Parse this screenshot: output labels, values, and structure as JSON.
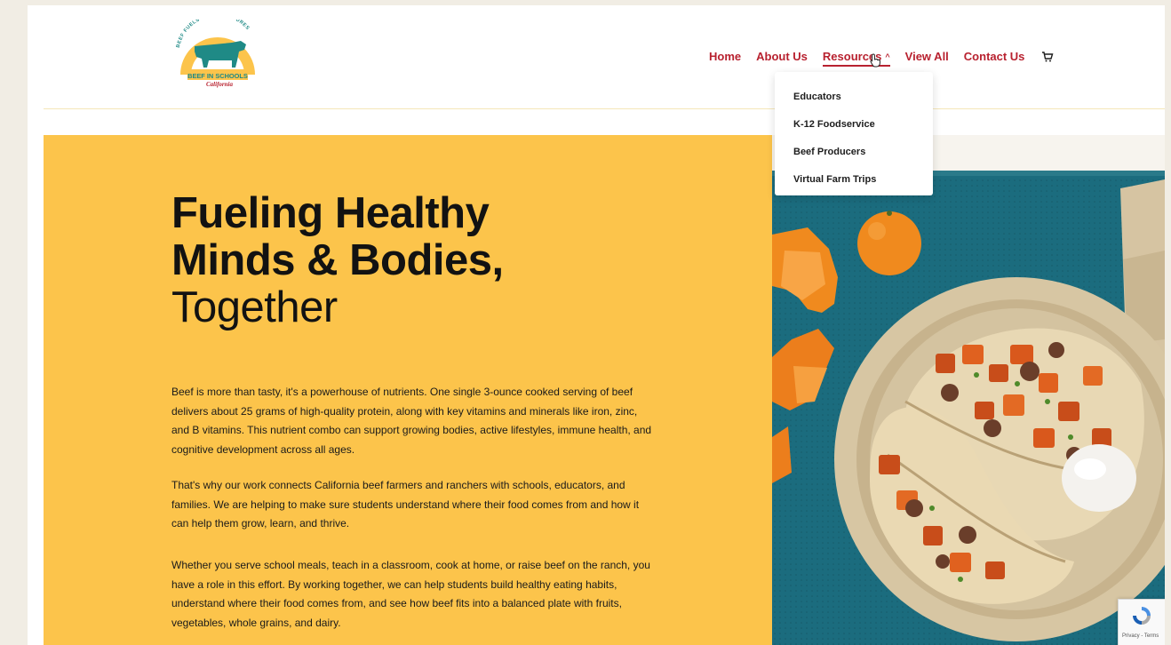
{
  "brand": {
    "tagline": "BEEF FUELS BRIGHT FUTURES",
    "name": "BEEF IN SCHOOLS",
    "region": "California"
  },
  "nav": {
    "home": "Home",
    "about": "About Us",
    "resources": "Resources",
    "view_all": "View All",
    "contact": "Contact Us"
  },
  "resources_menu": {
    "educators": "Educators",
    "k12": "K-12 Foodservice",
    "producers": "Beef Producers",
    "farm_trips": "Virtual Farm Trips"
  },
  "hero": {
    "title_line1": "Fueling Healthy",
    "title_line2": "Minds & Bodies,",
    "title_line3": "Together",
    "paragraph1": "Beef is more than tasty, it's a powerhouse of nutrients. One single 3-ounce cooked serving of beef delivers about 25 grams of high-quality protein, along with key vitamins and minerals like iron, zinc, and B vitamins. This nutrient combo can support growing bodies, active lifestyles, immune health, and cognitive development across all ages.",
    "paragraph2": "That's why our work connects California beef farmers and ranchers with schools, educators, and families. We are helping to make sure students understand where their food comes from and how it can help them grow, learn, and thrive.",
    "paragraph3": "Whether you serve school meals, teach in a classroom, cook at home, or raise beef on the ranch, you have a role in this effort. By working together, we can help students build healthy eating habits, understand where their food comes from, and see how beef fits into a balanced plate with fruits, vegetables, whole grains, and dairy."
  },
  "recaptcha": {
    "links": "Privacy - Terms"
  },
  "colors": {
    "accent": "#b8212f",
    "hero_bg": "#fcc44b",
    "tray": "#1b6c7e",
    "logo_teal": "#1f8a86"
  },
  "icons": {
    "cart": "cart-icon",
    "chevron": "chevron-up-icon",
    "recaptcha": "recaptcha-icon"
  }
}
